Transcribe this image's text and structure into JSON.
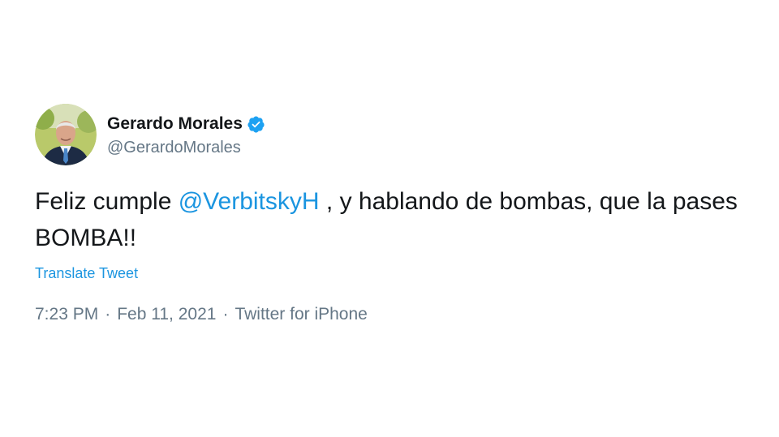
{
  "author": {
    "display_name": "Gerardo Morales",
    "handle": "@GerardoMorales",
    "verified": true,
    "avatar_icon": "profile-photo-avatar"
  },
  "tweet": {
    "text_prefix": "Feliz cumple ",
    "mention": "@VerbitskyH",
    "text_suffix": " , y hablando de bombas, que la pases BOMBA!!",
    "translate_label": "Translate Tweet"
  },
  "meta": {
    "time": "7:23 PM",
    "separator": "·",
    "date": "Feb 11, 2021",
    "source": "Twitter for iPhone"
  },
  "colors": {
    "link": "#1b95e0",
    "secondary_text": "#657786",
    "primary_text": "#14171a",
    "verified_badge": "#1da1f2"
  }
}
